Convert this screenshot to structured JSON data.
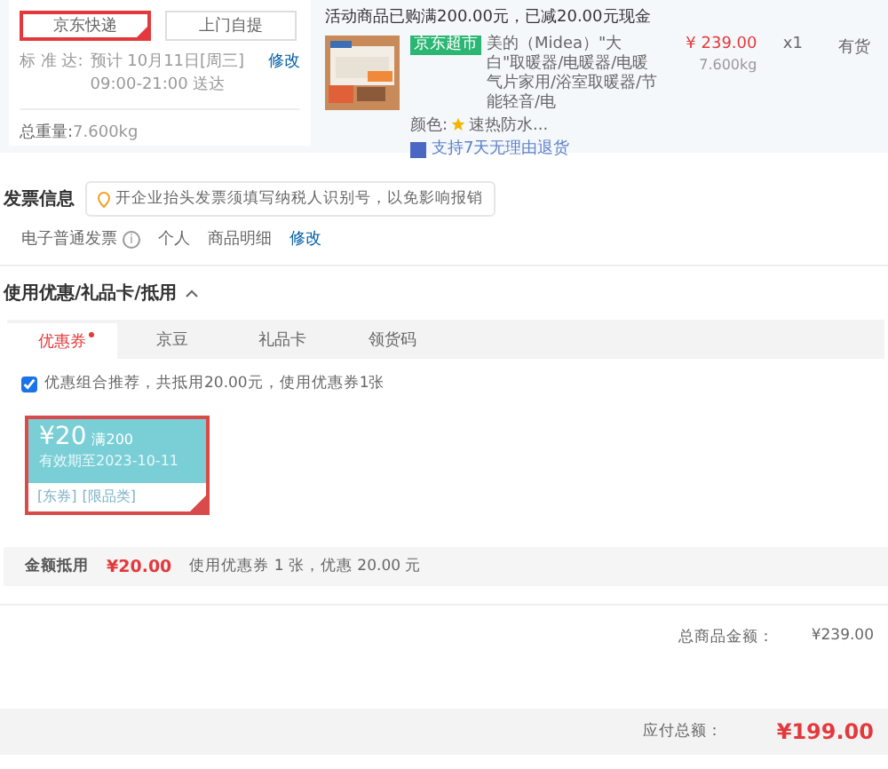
{
  "shipping": {
    "options": [
      {
        "label": "京东快递",
        "selected": true
      },
      {
        "label": "上门自提",
        "selected": false
      }
    ],
    "delivery_label": "标 准 达:",
    "delivery_time": "预计 10月11日[周三] 09:00-21:00 送达",
    "edit_link": "修改",
    "weight_label": "总重量:",
    "weight": "7.600kg"
  },
  "order": {
    "promo": "活动商品已购满200.00元，已减20.00元现金",
    "product": {
      "tag": "京东超市",
      "title": "美的（Midea）\"大白\"取暖器/电暖器/电暖气片家用/浴室取暖器/节能轻音/电",
      "price": "¥ 239.00",
      "weight": "7.600kg",
      "quantity": "x1",
      "stock": "有货",
      "color_label": "颜色:",
      "color_value": "速热防水...",
      "service": "支持7天无理由退货"
    }
  },
  "invoice": {
    "title": "发票信息",
    "tip": "开企业抬头发票须填写纳税人识别号，以免影响报销",
    "type": "电子普通发票",
    "info_icon": "i",
    "holder": "个人",
    "content": "商品明细",
    "edit_link": "修改"
  },
  "discount": {
    "title": "使用优惠/礼品卡/抵用",
    "expanded": true,
    "tabs": [
      {
        "label": "优惠券",
        "selected": true,
        "dot": true
      },
      {
        "label": "京豆",
        "selected": false,
        "dot": false
      },
      {
        "label": "礼品卡",
        "selected": false,
        "dot": false
      },
      {
        "label": "领货码",
        "selected": false,
        "dot": false
      }
    ],
    "recommend": {
      "checked": true,
      "label": "优惠组合推荐，共抵用20.00元，使用优惠券1张"
    },
    "coupons": [
      {
        "amount": "¥20",
        "condition": "满200",
        "expiry": "有效期至2023-10-11",
        "tags": [
          "[东券]",
          "[限品类]"
        ],
        "selected": true
      }
    ],
    "total_label": "金额抵用",
    "total": "¥20.00",
    "total_note": "使用优惠券 1 张，优惠 20.00 元"
  },
  "summary": {
    "rows": [
      {
        "label": "总商品金额：",
        "value": "¥239.00"
      }
    ],
    "payable_label": "应付总额：",
    "payable": "¥199.00"
  }
}
